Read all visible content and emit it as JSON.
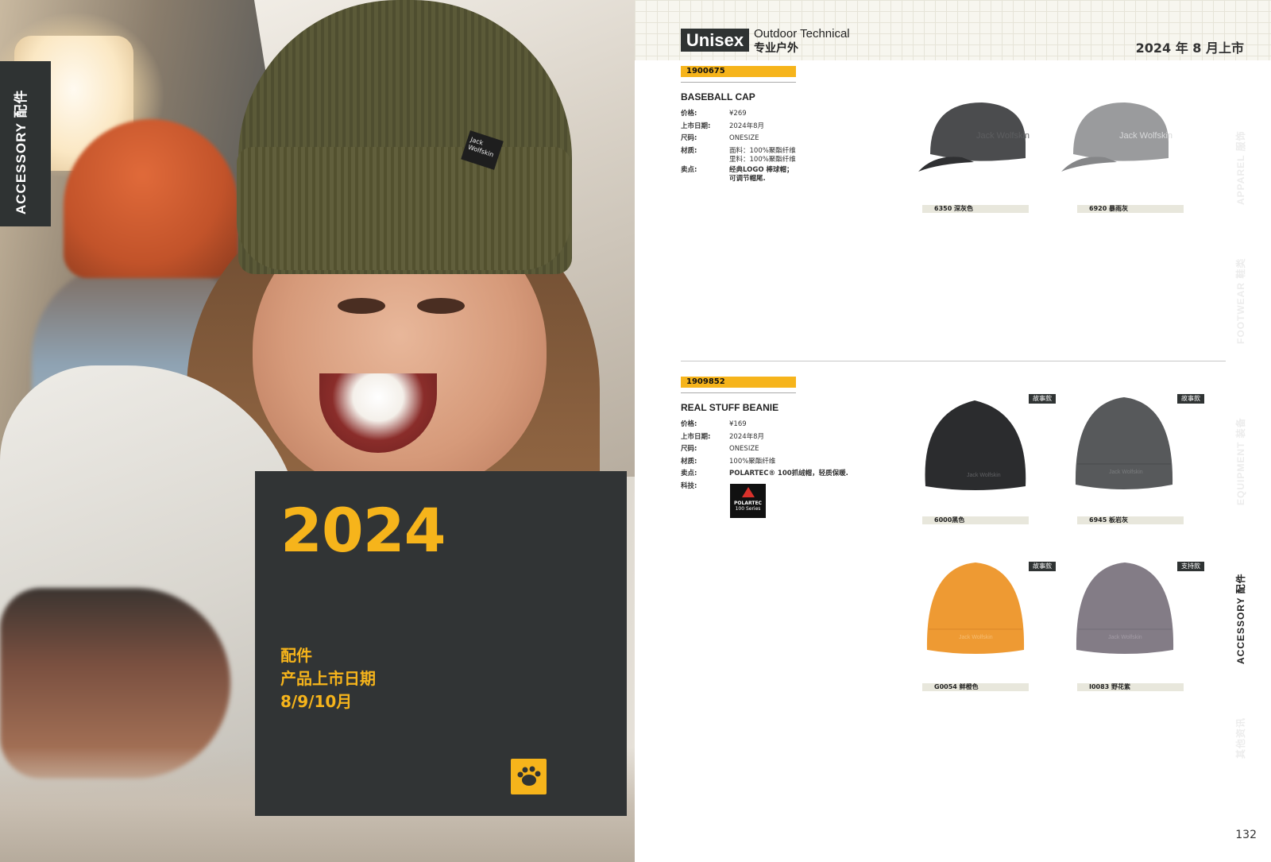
{
  "left_page": {
    "side_tab": "ACCESSORY 配件",
    "box": {
      "year": "2024",
      "lines": [
        "配件",
        "产品上市日期",
        "8/9/10月"
      ]
    },
    "beanie_label": "Jack Wolfskin"
  },
  "header": {
    "badge": "Unisex",
    "category_en": "Outdoor Technical",
    "category_cn": "专业户外",
    "launch": "2024 年 8 月上市"
  },
  "products": [
    {
      "sku": "1900675",
      "name": "BASEBALL CAP",
      "specs": [
        {
          "k": "价格:",
          "v": "¥269"
        },
        {
          "k": "上市日期:",
          "v": "2024年8月"
        },
        {
          "k": "尺码:",
          "v": "ONESIZE"
        },
        {
          "k": "材质:",
          "v": "面料：100%聚酯纤维\n里料：100%聚酯纤维"
        },
        {
          "k": "卖点:",
          "v": "经典LOGO 棒球帽；\n可调节帽尾."
        }
      ],
      "colors": [
        {
          "label": "6350 深灰色",
          "color": "#4b4c4e"
        },
        {
          "label": "6920 暴雨灰",
          "color": "#9a9b9d"
        }
      ]
    },
    {
      "sku": "1909852",
      "name": "REAL STUFF BEANIE",
      "specs": [
        {
          "k": "价格:",
          "v": "¥169"
        },
        {
          "k": "上市日期:",
          "v": "2024年8月"
        },
        {
          "k": "尺码:",
          "v": "ONESIZE"
        },
        {
          "k": "材质:",
          "v": "100%聚酯纤维"
        },
        {
          "k": "卖点:",
          "v": "POLARTEC® 100抓绒帽，轻质保暖."
        },
        {
          "k": "科技:",
          "v": ""
        }
      ],
      "tech_logo": {
        "title": "POLARTEC",
        "sub": "100 Series"
      },
      "colors": [
        {
          "label": "6000黑色",
          "color": "#2b2c2e",
          "tag": "故事款"
        },
        {
          "label": "6945 板岩灰",
          "color": "#57595b",
          "tag": "故事款"
        },
        {
          "label": "G0054 鲜橙色",
          "color": "#ee9a33",
          "tag": "故事款"
        },
        {
          "label": "I0083 野花紫",
          "color": "#837c86",
          "tag": "支持款"
        }
      ]
    }
  ],
  "side_nav": [
    {
      "label": "APPAREL 服饰",
      "active": false
    },
    {
      "label": "FOOTWEAR 鞋类",
      "active": false
    },
    {
      "label": "EQUIPMENT 装备",
      "active": false
    },
    {
      "label": "ACCESSORY 配件",
      "active": true
    },
    {
      "label": "其他资讯",
      "active": false
    }
  ],
  "page_number": "132",
  "colors": {
    "accent": "#f6b41b",
    "dark": "#2f3333"
  }
}
